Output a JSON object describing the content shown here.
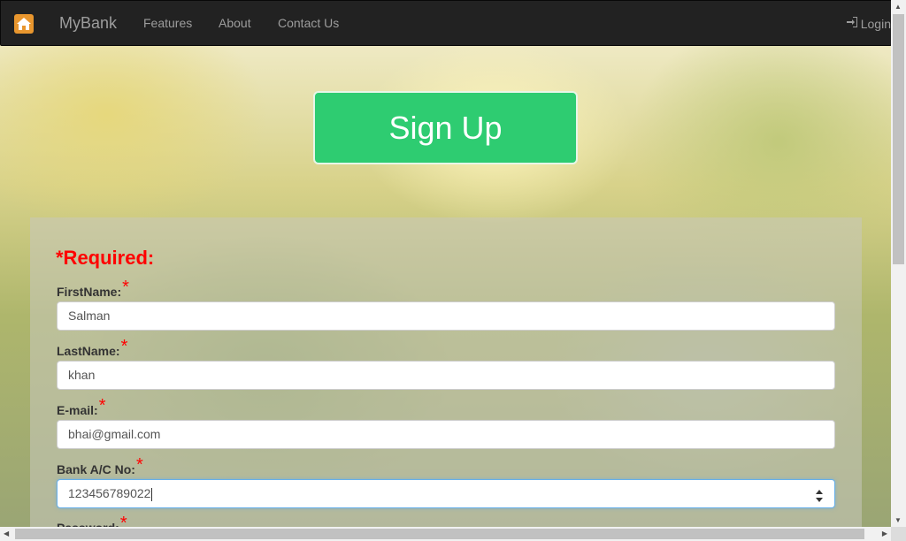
{
  "navbar": {
    "brand": "MyBank",
    "links": [
      "Features",
      "About",
      "Contact Us"
    ],
    "login_label": "Login"
  },
  "hero": {
    "signup_label": "Sign Up"
  },
  "form": {
    "required_heading": "*Required:",
    "fields": [
      {
        "label": "FirstName:",
        "value": "Salman"
      },
      {
        "label": "LastName:",
        "value": "khan"
      },
      {
        "label": "E-mail:",
        "value": "bhai@gmail.com"
      },
      {
        "label": "Bank A/C No:",
        "value": "123456789022"
      },
      {
        "label": "Password:",
        "value": ""
      }
    ],
    "required_mark": "*"
  },
  "colors": {
    "navbar_bg": "#222222",
    "signup_green": "#2ecc71",
    "required_red": "#ff0000",
    "home_icon": "#e8962e"
  },
  "icons": [
    "home-icon",
    "login-icon",
    "number-spinner-icon"
  ]
}
